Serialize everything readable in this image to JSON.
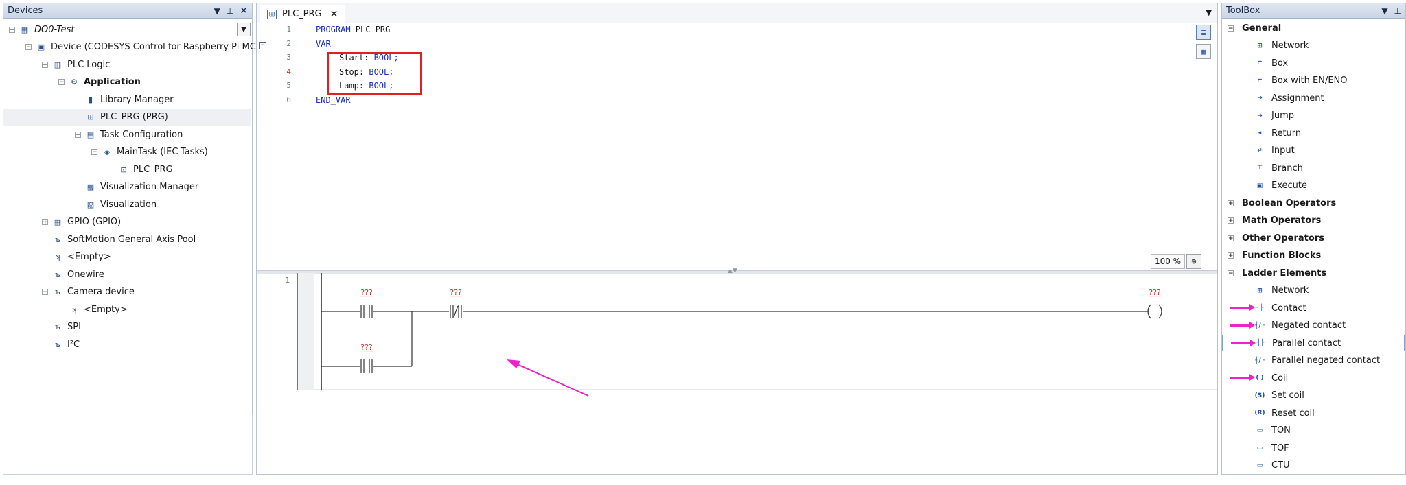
{
  "devices": {
    "title": "Devices",
    "items": [
      {
        "label": "DO0-Test",
        "depth": 0,
        "expander": "−",
        "style": "ital",
        "icon": "project-icon",
        "sym": "▦"
      },
      {
        "label": "Device (CODESYS Control for Raspberry Pi MC SL)",
        "depth": 1,
        "expander": "−",
        "style": "",
        "icon": "device-icon",
        "sym": "▣"
      },
      {
        "label": "PLC Logic",
        "depth": 2,
        "expander": "−",
        "style": "",
        "icon": "plc-logic-icon",
        "sym": "▥"
      },
      {
        "label": "Application",
        "depth": 3,
        "expander": "−",
        "style": "bold",
        "icon": "application-gear-icon",
        "sym": "⚙"
      },
      {
        "label": "Library Manager",
        "depth": 4,
        "expander": "",
        "style": "",
        "icon": "library-icon",
        "sym": "▮"
      },
      {
        "label": "PLC_PRG (PRG)",
        "depth": 4,
        "expander": "",
        "style": "",
        "icon": "program-icon",
        "sym": "⊞",
        "selected": true
      },
      {
        "label": "Task Configuration",
        "depth": 4,
        "expander": "−",
        "style": "",
        "icon": "task-config-icon",
        "sym": "▤"
      },
      {
        "label": "MainTask (IEC-Tasks)",
        "depth": 5,
        "expander": "−",
        "style": "",
        "icon": "task-icon",
        "sym": "◈"
      },
      {
        "label": "PLC_PRG",
        "depth": 6,
        "expander": "",
        "style": "",
        "icon": "program-call-icon",
        "sym": "⊡"
      },
      {
        "label": "Visualization Manager",
        "depth": 4,
        "expander": "",
        "style": "",
        "icon": "visu-manager-icon",
        "sym": "▩"
      },
      {
        "label": "Visualization",
        "depth": 4,
        "expander": "",
        "style": "",
        "icon": "visualization-icon",
        "sym": "▧"
      },
      {
        "label": "GPIO (GPIO)",
        "depth": 2,
        "expander": "+",
        "style": "",
        "icon": "gpio-icon",
        "sym": "▦"
      },
      {
        "label": "SoftMotion General Axis Pool",
        "depth": 2,
        "expander": "",
        "style": "",
        "icon": "axis-pool-icon",
        "sym": "ъ"
      },
      {
        "label": "<Empty>",
        "depth": 2,
        "expander": "",
        "style": "",
        "icon": "empty-slot-icon",
        "sym": "ʞ"
      },
      {
        "label": "Onewire",
        "depth": 2,
        "expander": "",
        "style": "",
        "icon": "onewire-icon",
        "sym": "ъ"
      },
      {
        "label": "Camera device",
        "depth": 2,
        "expander": "−",
        "style": "",
        "icon": "camera-device-icon",
        "sym": "ъ"
      },
      {
        "label": "<Empty>",
        "depth": 3,
        "expander": "",
        "style": "",
        "icon": "empty-slot-icon",
        "sym": "ʞ"
      },
      {
        "label": "SPI",
        "depth": 2,
        "expander": "",
        "style": "",
        "icon": "spi-icon",
        "sym": "ъ"
      },
      {
        "label": "I²C",
        "depth": 2,
        "expander": "",
        "style": "",
        "icon": "i2c-icon",
        "sym": "ъ"
      }
    ]
  },
  "editor": {
    "tab_label": "PLC_PRG",
    "code_lines": [
      {
        "n": "1",
        "text": "PROGRAM PLC_PRG",
        "indent": 0,
        "kw": true
      },
      {
        "n": "2",
        "text": "VAR",
        "indent": 0,
        "kw": true
      },
      {
        "n": "3",
        "text": "Start: BOOL;",
        "indent": 1,
        "kw": false
      },
      {
        "n": "4",
        "text": "Stop: BOOL;",
        "indent": 1,
        "kw": false,
        "red": true
      },
      {
        "n": "5",
        "text": "Lamp: BOOL;",
        "indent": 1,
        "kw": false
      },
      {
        "n": "6",
        "text": "END_VAR",
        "indent": 0,
        "kw": true
      }
    ],
    "zoom": "100 %",
    "ladder": {
      "rung_number": "1",
      "placeholder": "???"
    }
  },
  "toolbox": {
    "title": "ToolBox",
    "rows": [
      {
        "type": "hdr",
        "label": "General",
        "exp": "−"
      },
      {
        "type": "item",
        "label": "Network",
        "sym": "⊞",
        "icon": "network-icon"
      },
      {
        "type": "item",
        "label": "Box",
        "sym": "⊏",
        "icon": "box-icon"
      },
      {
        "type": "item",
        "label": "Box with EN/ENO",
        "sym": "⊏",
        "icon": "box-en-eno-icon"
      },
      {
        "type": "item",
        "label": "Assignment",
        "sym": "→",
        "icon": "assignment-icon"
      },
      {
        "type": "item",
        "label": "Jump",
        "sym": "→",
        "icon": "jump-icon"
      },
      {
        "type": "item",
        "label": "Return",
        "sym": "◂",
        "icon": "return-icon"
      },
      {
        "type": "item",
        "label": "Input",
        "sym": "↵",
        "icon": "input-icon"
      },
      {
        "type": "item",
        "label": "Branch",
        "sym": "⊤",
        "icon": "branch-icon"
      },
      {
        "type": "item",
        "label": "Execute",
        "sym": "▣",
        "icon": "execute-icon"
      },
      {
        "type": "hdr",
        "label": "Boolean Operators",
        "exp": "+"
      },
      {
        "type": "hdr",
        "label": "Math Operators",
        "exp": "+"
      },
      {
        "type": "hdr",
        "label": "Other Operators",
        "exp": "+"
      },
      {
        "type": "hdr",
        "label": "Function Blocks",
        "exp": "+"
      },
      {
        "type": "hdr",
        "label": "Ladder Elements",
        "exp": "−"
      },
      {
        "type": "item",
        "label": "Network",
        "sym": "⊞",
        "icon": "network-icon"
      },
      {
        "type": "item",
        "label": "Contact",
        "sym": "┤├",
        "icon": "contact-icon",
        "arrow": true
      },
      {
        "type": "item",
        "label": "Negated contact",
        "sym": "┤/├",
        "icon": "negated-contact-icon",
        "arrow": true
      },
      {
        "type": "item",
        "label": "Parallel contact",
        "sym": "┤├",
        "icon": "parallel-contact-icon",
        "arrow": true,
        "hl": true
      },
      {
        "type": "item",
        "label": "Parallel negated contact",
        "sym": "┤/├",
        "icon": "parallel-negated-contact-icon"
      },
      {
        "type": "item",
        "label": "Coil",
        "sym": "( )",
        "icon": "coil-icon",
        "arrow": true
      },
      {
        "type": "item",
        "label": "Set coil",
        "sym": "(S)",
        "icon": "set-coil-icon"
      },
      {
        "type": "item",
        "label": "Reset coil",
        "sym": "(R)",
        "icon": "reset-coil-icon"
      },
      {
        "type": "item",
        "label": "TON",
        "sym": "▭",
        "icon": "ton-icon"
      },
      {
        "type": "item",
        "label": "TOF",
        "sym": "▭",
        "icon": "tof-icon"
      },
      {
        "type": "item",
        "label": "CTU",
        "sym": "▭",
        "icon": "ctu-icon"
      }
    ]
  },
  "colors": {
    "annotation_arrow": "#ee22cc",
    "highlight_box": "#e02020",
    "keyword": "#1c2fb8",
    "placeholder": "#c0392b"
  }
}
